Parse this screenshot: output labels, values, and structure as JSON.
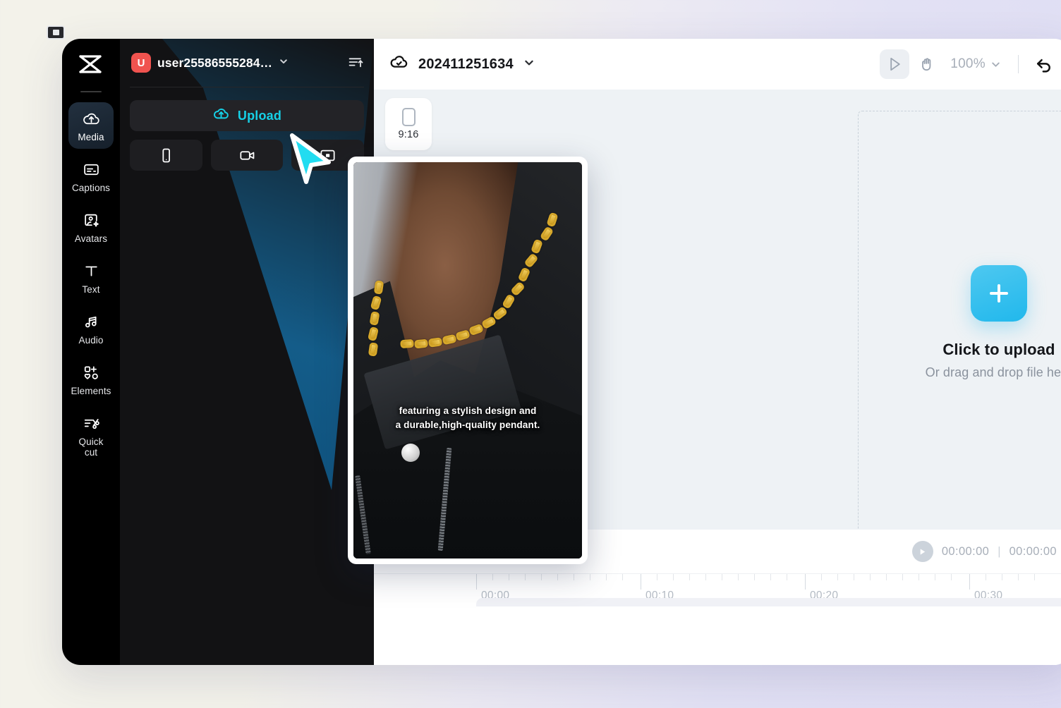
{
  "app": {
    "logo_icon": "capcut-logo-icon"
  },
  "sidebar": {
    "items": [
      {
        "label": "Media",
        "icon": "cloud-upload-icon",
        "active": true
      },
      {
        "label": "Captions",
        "icon": "captions-icon",
        "active": false
      },
      {
        "label": "Avatars",
        "icon": "avatar-sparkle-icon",
        "active": false
      },
      {
        "label": "Text",
        "icon": "text-t-icon",
        "active": false
      },
      {
        "label": "Audio",
        "icon": "music-note-icon",
        "active": false
      },
      {
        "label": "Elements",
        "icon": "elements-icon",
        "active": false
      },
      {
        "label": "Quick\ncut",
        "label_line1": "Quick",
        "label_line2": "cut",
        "icon": "quick-cut-icon",
        "active": false
      }
    ]
  },
  "media_panel": {
    "account_badge": "U",
    "account_name": "user25586555284…",
    "account_chevron_icon": "chevron-down-icon",
    "sort_icon": "sort-ascending-icon",
    "upload_button": {
      "label": "Upload",
      "icon": "cloud-upload-icon",
      "color": "#16d0e6"
    },
    "quick_buttons": [
      {
        "icon": "mobile-phone-icon",
        "name": "upload-from-phone"
      },
      {
        "icon": "video-camera-icon",
        "name": "record-video"
      },
      {
        "icon": "screen-record-icon",
        "name": "record-screen"
      }
    ]
  },
  "top_bar": {
    "cloud_icon": "cloud-check-icon",
    "project_name": "202411251634",
    "project_chevron_icon": "chevron-down-icon",
    "tools": [
      {
        "name": "select-tool",
        "icon": "cursor-arrow-icon",
        "selected": true
      },
      {
        "name": "hand-tool",
        "icon": "hand-icon",
        "selected": false
      }
    ],
    "zoom": {
      "value": "100%",
      "chevron_icon": "chevron-down-icon"
    },
    "undo_icon": "undo-arrow-icon"
  },
  "canvas": {
    "ratio_card": {
      "label": "9:16",
      "icon": "portrait-frame-icon"
    },
    "drop_zone": {
      "plus_icon": "plus-icon",
      "title": "Click to upload",
      "subtitle": "Or drag and drop file here",
      "accent": "#2ab8ec"
    }
  },
  "timeline": {
    "tools": [
      {
        "name": "split-clip-button",
        "icon": "split-icon"
      },
      {
        "name": "delete-clip-button",
        "icon": "trash-icon"
      }
    ],
    "play_icon": "play-icon",
    "current_time": "00:00:00",
    "separator": "|",
    "total_time": "00:00:00",
    "ruler_labels": [
      "00:00",
      "00:10",
      "00:20",
      "00:30"
    ]
  },
  "preview_card": {
    "caption_line1": "featuring a stylish design and",
    "caption_line2": "a durable,high-quality pendant.",
    "description": "video preview of gold chain necklace over black leather jacket"
  },
  "cursor": {
    "name": "drag-cursor",
    "color": "#22dcf0"
  }
}
